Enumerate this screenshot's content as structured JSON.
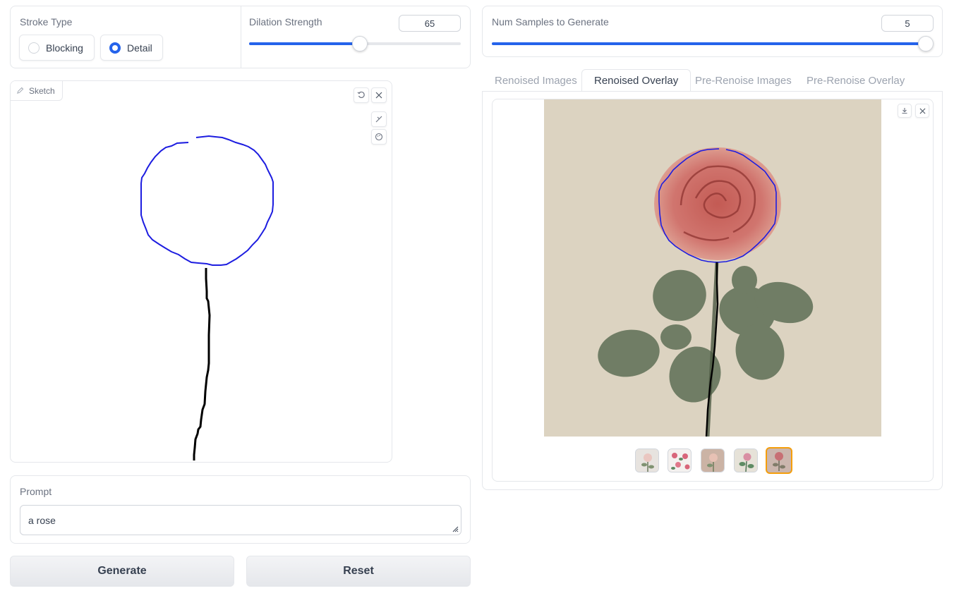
{
  "stroke_type": {
    "label": "Stroke Type",
    "options": [
      "Blocking",
      "Detail"
    ],
    "selected": "Detail"
  },
  "dilation": {
    "label": "Dilation Strength",
    "value": "65",
    "fraction": 0.5
  },
  "sketch": {
    "tag_label": "Sketch"
  },
  "prompt": {
    "label": "Prompt",
    "value": "a rose"
  },
  "buttons": {
    "generate": "Generate",
    "reset": "Reset"
  },
  "samples": {
    "label": "Num Samples to Generate",
    "value": "5",
    "fraction": 1.0
  },
  "tabs": [
    "Renoised Images",
    "Renoised Overlay",
    "Pre-Renoise Images",
    "Pre-Renoise Overlay"
  ],
  "active_tab": "Renoised Overlay",
  "gallery": {
    "thumbnail_count": 5,
    "selected_index": 4
  },
  "colors": {
    "accent": "#2563eb",
    "sketch_blue": "#1d1de0",
    "sketch_black": "#000000",
    "selected_thumb_border": "#f59e0b"
  }
}
